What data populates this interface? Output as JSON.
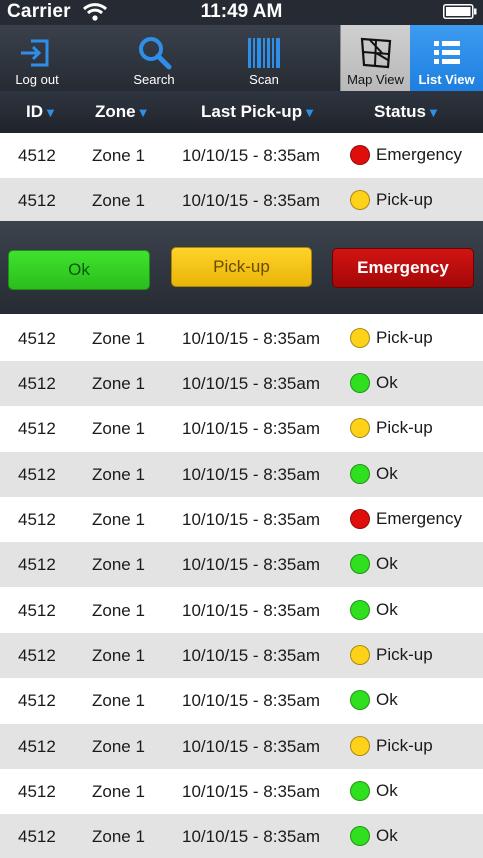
{
  "status_bar": {
    "carrier": "Carrier",
    "time": "11:49 AM"
  },
  "toolbar": {
    "logout_label": "Log out",
    "search_label": "Search",
    "scan_label": "Scan",
    "map_label": "Map View",
    "list_label": "List View"
  },
  "header": {
    "id": "ID",
    "zone": "Zone",
    "last_pickup": "Last Pick-up",
    "status": "Status",
    "sort_caret": "▼"
  },
  "actions": {
    "ok": "Ok",
    "pickup": "Pick-up",
    "emergency": "Emergency"
  },
  "colors": {
    "emergency": "#e00d0d",
    "pickup": "#ffd21a",
    "ok": "#2fe01f",
    "accent": "#1e7fe0"
  },
  "rows": [
    {
      "id": "4512",
      "zone": "Zone 1",
      "date": "10/10/15 - 8:35am",
      "status": "Emergency",
      "color": "#e00d0d"
    },
    {
      "id": "4512",
      "zone": "Zone 1",
      "date": "10/10/15 - 8:35am",
      "status": "Pick-up",
      "color": "#ffd21a"
    },
    {
      "id": "4512",
      "zone": "Zone 1",
      "date": "10/10/15 - 8:35am",
      "status": "Pick-up",
      "color": "#ffd21a"
    },
    {
      "id": "4512",
      "zone": "Zone 1",
      "date": "10/10/15 - 8:35am",
      "status": "Ok",
      "color": "#2fe01f"
    },
    {
      "id": "4512",
      "zone": "Zone 1",
      "date": "10/10/15 - 8:35am",
      "status": "Pick-up",
      "color": "#ffd21a"
    },
    {
      "id": "4512",
      "zone": "Zone 1",
      "date": "10/10/15 - 8:35am",
      "status": "Ok",
      "color": "#2fe01f"
    },
    {
      "id": "4512",
      "zone": "Zone 1",
      "date": "10/10/15 - 8:35am",
      "status": "Emergency",
      "color": "#e00d0d"
    },
    {
      "id": "4512",
      "zone": "Zone 1",
      "date": "10/10/15 - 8:35am",
      "status": "Ok",
      "color": "#2fe01f"
    },
    {
      "id": "4512",
      "zone": "Zone 1",
      "date": "10/10/15 - 8:35am",
      "status": "Ok",
      "color": "#2fe01f"
    },
    {
      "id": "4512",
      "zone": "Zone 1",
      "date": "10/10/15 - 8:35am",
      "status": "Pick-up",
      "color": "#ffd21a"
    },
    {
      "id": "4512",
      "zone": "Zone 1",
      "date": "10/10/15 - 8:35am",
      "status": "Ok",
      "color": "#2fe01f"
    },
    {
      "id": "4512",
      "zone": "Zone 1",
      "date": "10/10/15 - 8:35am",
      "status": "Pick-up",
      "color": "#ffd21a"
    },
    {
      "id": "4512",
      "zone": "Zone 1",
      "date": "10/10/15 - 8:35am",
      "status": "Ok",
      "color": "#2fe01f"
    },
    {
      "id": "4512",
      "zone": "Zone 1",
      "date": "10/10/15 - 8:35am",
      "status": "Ok",
      "color": "#2fe01f"
    }
  ]
}
